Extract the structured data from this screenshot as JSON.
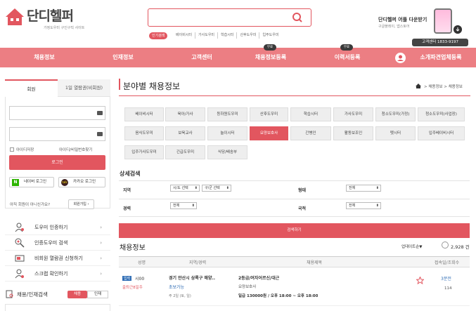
{
  "header": {
    "logo_text": "단디헬퍼",
    "logo_sub": "가정도우미 구인구직 사이트",
    "hot_badge": "인기검색",
    "hot_links": [
      "베이비시터",
      "가사도우미",
      "학습시터",
      "산후도우미",
      "입주도우미"
    ],
    "app_title": "단디헬퍼 어플 다운받기",
    "app_sub": "구글플레이, 앱스토어",
    "call": "고객센터 1833-9197"
  },
  "nav": {
    "items": [
      "채용정보",
      "인재정보",
      "고객센터",
      "채용정보등록",
      "이력서등록",
      "소개파견업체등록"
    ],
    "badge": "무료"
  },
  "login": {
    "tab_member": "회원",
    "tab_day": "1일 열람권(비회원)",
    "save_id": "아이디저장",
    "find": "아이디/비밀번호찾기",
    "login_btn": "로그인",
    "naver": "네이버 로그인",
    "naver_icon": "N",
    "kakao": "카카오 로그인",
    "kakao_icon": "talk",
    "not_member": "아직 회원이 아니신가요?",
    "join": "회원가입 ›"
  },
  "side_menu": {
    "items": [
      "도우미 인증하기",
      "인증도우미 검색",
      "비회원 열람권 신청하기",
      "스크랩 확인하기"
    ],
    "chev": "›",
    "search_label": "채용/인재검색",
    "toggle_on": "채용",
    "toggle_off": "인재"
  },
  "main": {
    "title": "분야별 채용정보",
    "crumb": "> 채용정보 > 채용정보",
    "categories": [
      [
        "베이비시터",
        "육아/가사",
        "등하원도우미",
        "산후도우미",
        "학습시터",
        "가사도우미",
        "청소도우미(가정)",
        "청소도우미(사업장)"
      ],
      [
        "음식도우미",
        "보육교사",
        "놀이시터",
        "요양보호사",
        "간병인",
        "활동보조인",
        "펫시터",
        "입주베이비시터"
      ],
      [
        "입주가사도우미",
        "긴급도우미",
        "식당/배송부"
      ]
    ],
    "active_category": "요양보호사",
    "detail_title": "상세검색",
    "region_label": "지역",
    "region_sel1": "시/도 선택",
    "region_sel2": "구/군 선택",
    "type_label": "형태",
    "type_val": "전체",
    "career_label": "경력",
    "career_val": "전체",
    "nation_label": "국적",
    "nation_val": "전체",
    "search_btn": "검색하기",
    "list_title": "채용정보",
    "sort": "업데이트순▼",
    "count": "2,928 건",
    "cols": [
      "성명",
      "지역/경력",
      "채용제목",
      "접속일/조회수"
    ],
    "row": {
      "badge": "입력",
      "name": "시00",
      "commute": "출퇴근8일주",
      "region": "경기 안산시 상록구 해양..",
      "career": "초보가능",
      "schedule": "주 2일 (토, 일)",
      "job_title": "2등급/여자어르신/대근",
      "company": "요양보호사",
      "pay": "일급 130000원 / 오후 18:00 ~ 오후 18:00",
      "ago": "3분전",
      "views": "114"
    }
  },
  "colors": {
    "accent": "#e2565f",
    "nav": "#ec7e83"
  }
}
